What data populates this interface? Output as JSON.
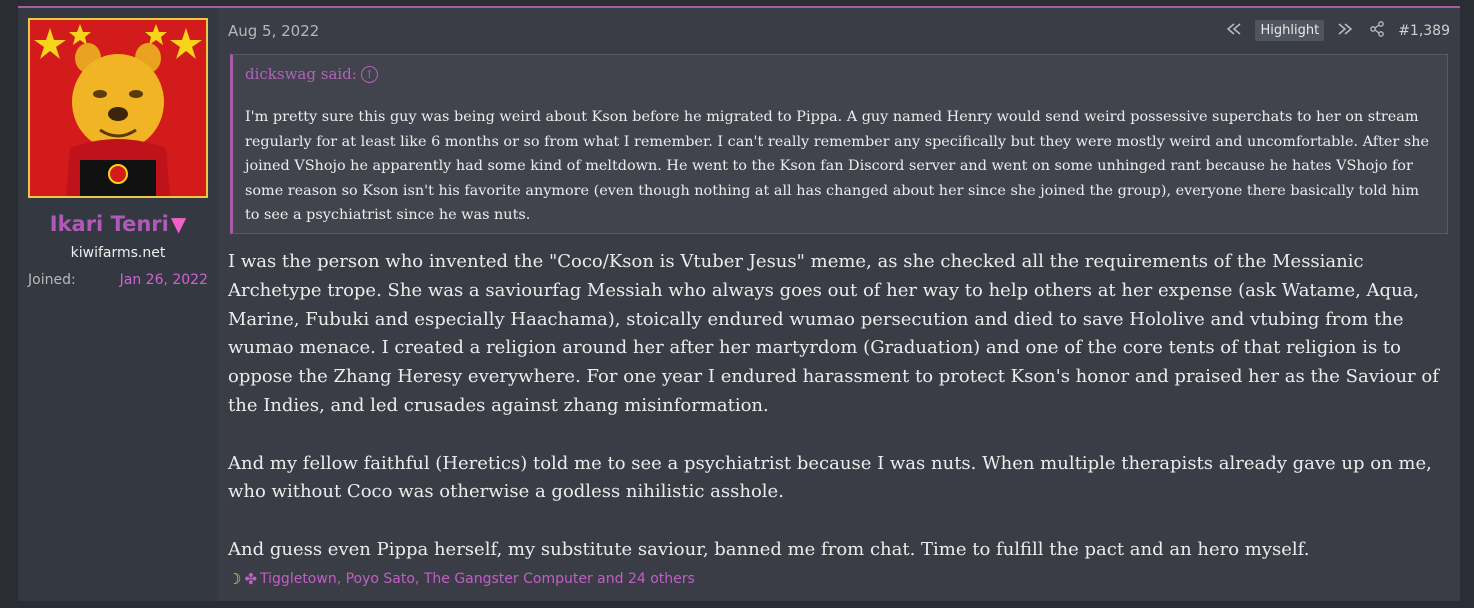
{
  "user": {
    "name": "Ikari Tenri",
    "title": "kiwifarms.net",
    "joined_label": "Joined:",
    "joined_date": "Jan 26, 2022"
  },
  "post": {
    "date": "Aug 5, 2022",
    "highlight_label": "Highlight",
    "number": "#1,389",
    "quote_author": "dickswag said:",
    "quote_text": "I'm pretty sure this guy was being weird about Kson before he migrated to Pippa. A guy named Henry would send weird possessive superchats to her on stream regularly for at least like 6 months or so from what I remember. I can't really remember any specifically but they were mostly weird and uncomfortable. After she joined VShojo he apparently had some kind of meltdown. He went to the Kson fan Discord server and went on some unhinged rant because he hates VShojo for some reason so Kson isn't his favorite anymore (even though nothing at all has changed about her since she joined the group), everyone there basically told him to see a psychiatrist since he was nuts.",
    "paragraphs": [
      "I was the person who invented the \"Coco/Kson is Vtuber Jesus\" meme, as she checked all the requirements of the Messianic Archetype trope. She was a saviourfag Messiah who always goes out of her way to help others at her expense (ask Watame, Aqua, Marine, Fubuki and especially Haachama), stoically endured wumao persecution and died to save Hololive and vtubing from the wumao menace. I created a religion around her after her martyrdom (Graduation) and one of the core tents of that religion is to oppose the Zhang Heresy everywhere. For one year I endured harassment to protect Kson's honor and praised her as the Saviour of the Indies, and led crusades against zhang misinformation.",
      "And my fellow faithful (Heretics) told me to see a psychiatrist because I was nuts. When multiple therapists already gave up on me, who without Coco was otherwise a godless nihilistic asshole.",
      "And guess even Pippa herself, my substitute saviour, banned me from chat. Time to fulfill the pact and an hero myself."
    ],
    "reactions_text": "Tiggletown, Poyo Sato, The Gangster Computer and 24 others"
  },
  "colors": {
    "accent": "#a85ca8",
    "username": "#b05ab8",
    "joined_date": "#d160d8",
    "background": "#3a3d45"
  },
  "icons": [
    "prev-post-icon",
    "next-post-icon",
    "share-icon",
    "up-arrow-icon",
    "crescent-moon-icon",
    "puzzle-icon"
  ]
}
